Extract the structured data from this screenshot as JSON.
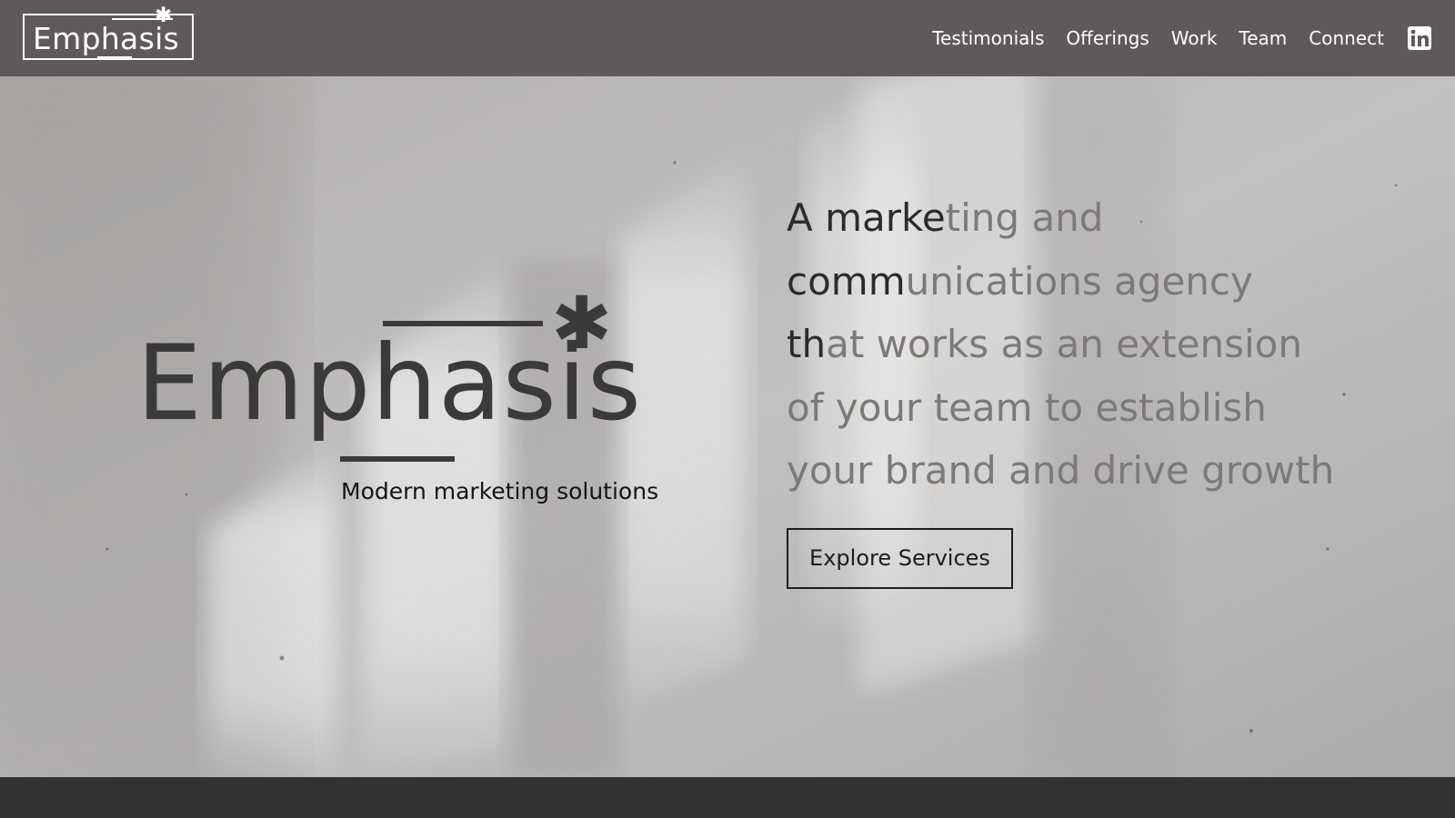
{
  "header": {
    "brand": "Emphasis",
    "nav": [
      {
        "label": "Testimonials"
      },
      {
        "label": "Offerings"
      },
      {
        "label": "Work"
      },
      {
        "label": "Team"
      },
      {
        "label": "Connect"
      }
    ],
    "social_icon": "linkedin-icon"
  },
  "hero": {
    "logo_word": "Emphasis",
    "tagline": "Modern marketing solutions",
    "copy_lines": [
      {
        "dark": "A marke",
        "light": "ting and"
      },
      {
        "dark": "comm",
        "light": "unications agency"
      },
      {
        "dark": "th",
        "light": "at works as an extension"
      },
      {
        "dark": "",
        "light": "of your team to establish"
      },
      {
        "dark": "",
        "light": "your brand and drive growth"
      }
    ],
    "cta_label": "Explore Services"
  },
  "colors": {
    "header_bg": "#5f5a59",
    "hero_text_dark": "#2b2b2b",
    "hero_text_light": "#7c7977",
    "footer_bg": "#323232"
  }
}
